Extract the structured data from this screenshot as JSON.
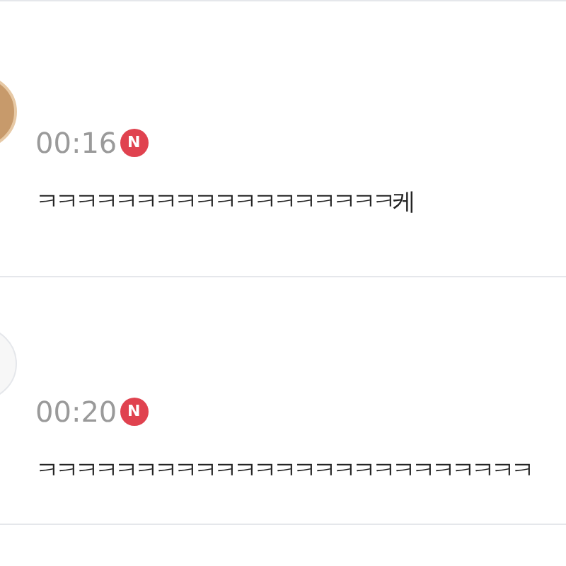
{
  "comments": [
    {
      "kind": "photo",
      "time": "00:16",
      "badge": "N",
      "text": "ㅋㅋㅋㅋㅋㅋㅋㅋㅋㅋㅋㅋㅋㅋㅋㅋㅋㅋ케"
    },
    {
      "kind": "blank",
      "time": "00:20",
      "badge": "N",
      "text": "ㅋㅋㅋㅋㅋㅋㅋㅋㅋㅋㅋㅋㅋㅋㅋㅋㅋㅋㅋㅋㅋㅋㅋㅋㅋ"
    }
  ]
}
